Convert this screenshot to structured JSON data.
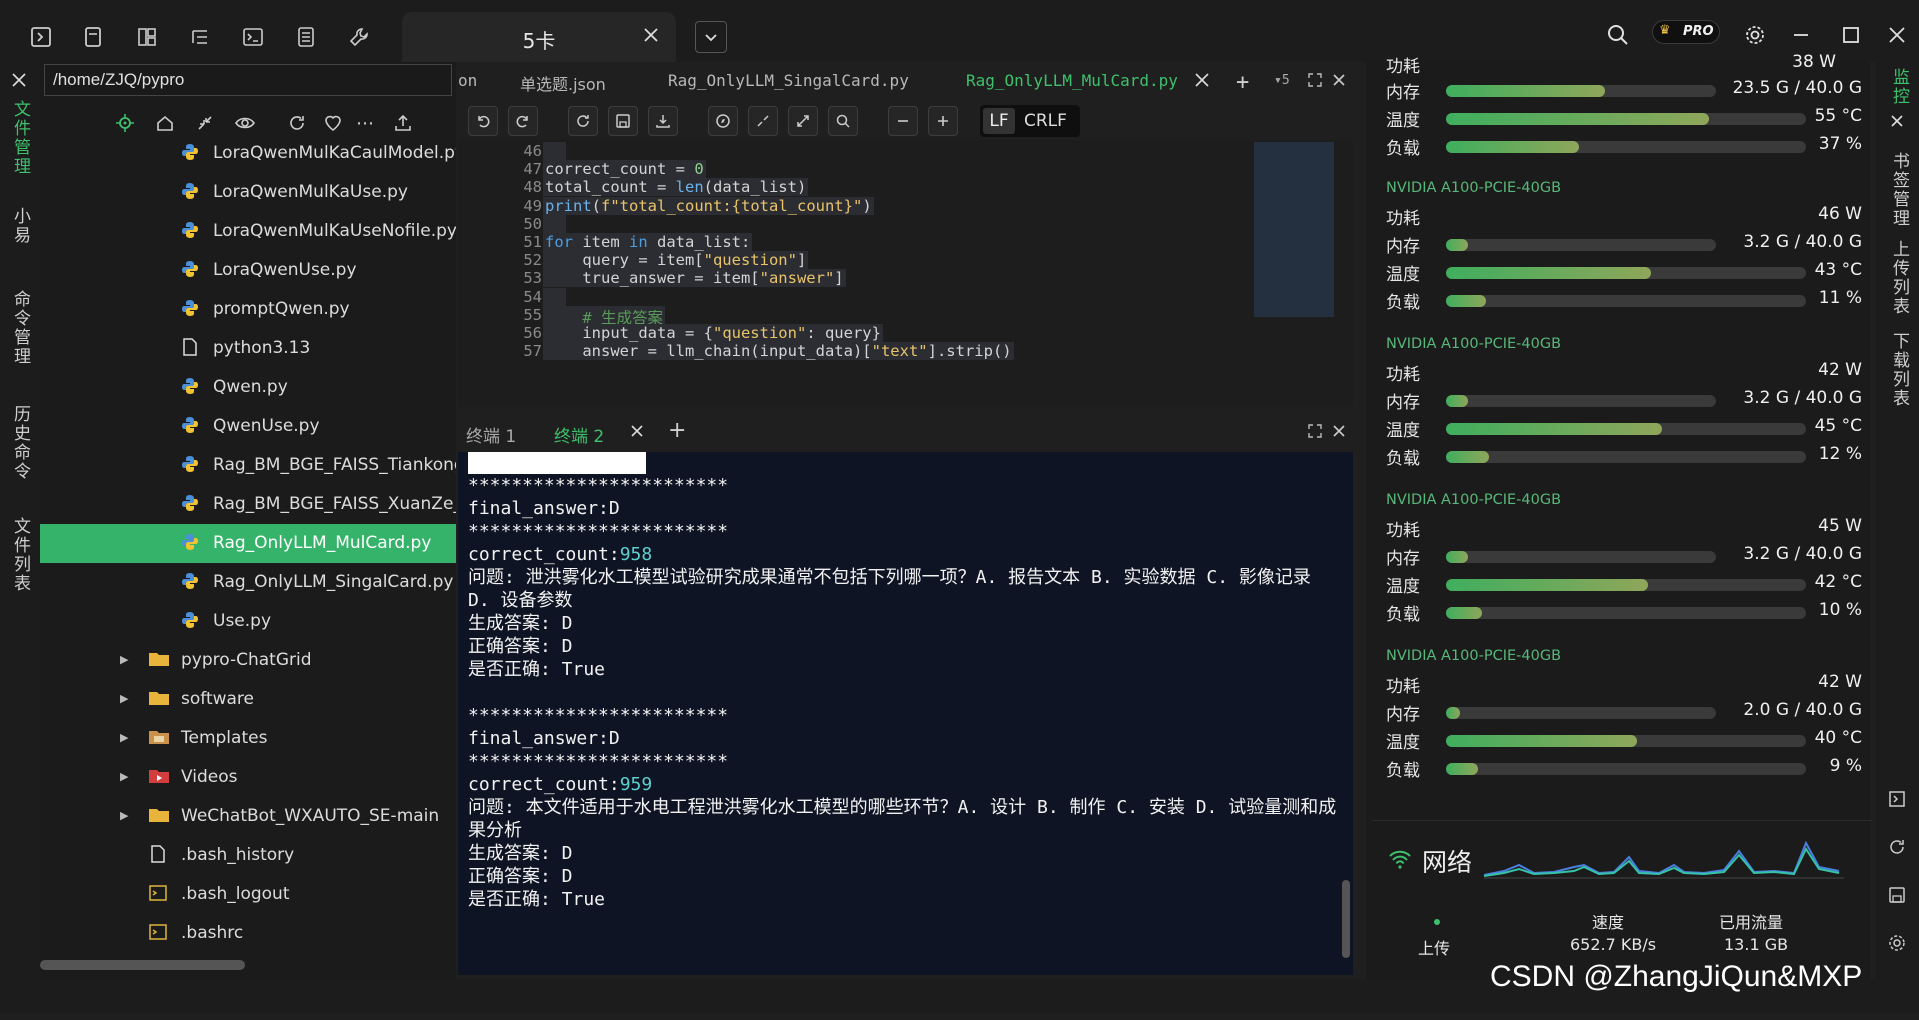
{
  "window": {
    "tab_title": "5卡"
  },
  "left_strip": {
    "items": [
      "文件管理",
      "小易",
      "命令管理",
      "历史命令",
      "文件列表"
    ]
  },
  "file_panel": {
    "path": "/home/ZJQ/pypro",
    "tree": [
      {
        "label": "LoraQwenMulKaCaulModel.py",
        "type": "py",
        "indent": 2
      },
      {
        "label": "LoraQwenMulKaUse.py",
        "type": "py",
        "indent": 2
      },
      {
        "label": "LoraQwenMulKaUseNofile.py",
        "type": "py",
        "indent": 2
      },
      {
        "label": "LoraQwenUse.py",
        "type": "py",
        "indent": 2
      },
      {
        "label": "promptQwen.py",
        "type": "py",
        "indent": 2
      },
      {
        "label": "python3.13",
        "type": "file",
        "indent": 2
      },
      {
        "label": "Qwen.py",
        "type": "py",
        "indent": 2
      },
      {
        "label": "QwenUse.py",
        "type": "py",
        "indent": 2
      },
      {
        "label": "Rag_BM_BGE_FAISS_Tiankong",
        "type": "py",
        "indent": 2
      },
      {
        "label": "Rag_BM_BGE_FAISS_XuanZe_F",
        "type": "py",
        "indent": 2
      },
      {
        "label": "Rag_OnlyLLM_MulCard.py",
        "type": "py",
        "indent": 2,
        "selected": true
      },
      {
        "label": "Rag_OnlyLLM_SingalCard.py",
        "type": "py",
        "indent": 2
      },
      {
        "label": "Use.py",
        "type": "py",
        "indent": 2
      },
      {
        "label": "pypro-ChatGrid",
        "type": "folder",
        "indent": 1
      },
      {
        "label": "software",
        "type": "folder",
        "indent": 1
      },
      {
        "label": "Templates",
        "type": "folder-t",
        "indent": 1
      },
      {
        "label": "Videos",
        "type": "folder-v",
        "indent": 1
      },
      {
        "label": "WeChatBot_WXAUTO_SE-main",
        "type": "folder",
        "indent": 1
      },
      {
        "label": ".bash_history",
        "type": "file",
        "indent": 1
      },
      {
        "label": ".bash_logout",
        "type": "term",
        "indent": 1
      },
      {
        "label": ".bashrc",
        "type": "term",
        "indent": 1
      }
    ]
  },
  "editor": {
    "tabs": [
      "on",
      "单选题.json",
      "Rag_OnlyLLM_SingalCard.py",
      "Rag_OnlyLLM_MulCard.py"
    ],
    "tab_count": "5",
    "line_ending": [
      "LF",
      "CRLF"
    ],
    "lines": [
      {
        "n": "46",
        "html": ""
      },
      {
        "n": "47",
        "html": "correct_count = <span class='nm'>0</span>"
      },
      {
        "n": "48",
        "html": "total_count = <span class='fn'>len</span>(data_list)"
      },
      {
        "n": "49",
        "html": "<span class='fn'>print</span>(<span class='st'>f\"total_count:{total_count}\"</span>)"
      },
      {
        "n": "50",
        "html": ""
      },
      {
        "n": "51",
        "html": "<span class='kw'>for</span> item <span class='kw'>in</span> data_list:"
      },
      {
        "n": "52",
        "html": "    query = item[<span class='st'>\"question\"</span>]"
      },
      {
        "n": "53",
        "html": "    true_answer = item[<span class='st'>\"answer\"</span>]"
      },
      {
        "n": "54",
        "html": ""
      },
      {
        "n": "55",
        "html": "    <span class='cm'># 生成答案</span>"
      },
      {
        "n": "56",
        "html": "    input_data = {<span class='st'>\"question\"</span>: query}"
      },
      {
        "n": "57",
        "html": "    answer = llm_chain(input_data)[<span class='st'>\"text\"</span>].strip()"
      }
    ]
  },
  "terminal": {
    "tabs": [
      "终端 1",
      "终端 2"
    ],
    "lines": [
      {
        "t": "************************"
      },
      {
        "t": "final_answer:D"
      },
      {
        "t": "************************"
      },
      {
        "t": "correct_count:",
        "n": "958"
      },
      {
        "t": "问题: 泄洪雾化水工模型试验研究成果通常不包括下列哪一项？A. 报告文本 B. 实验数据 C. 影像记录 D. 设备参数"
      },
      {
        "t": "生成答案: D"
      },
      {
        "t": "正确答案: D"
      },
      {
        "t": "是否正确: True"
      },
      {
        "t": " "
      },
      {
        "t": "************************"
      },
      {
        "t": "final_answer:D"
      },
      {
        "t": "************************"
      },
      {
        "t": "correct_count:",
        "n": "959"
      },
      {
        "t": "问题: 本文件适用于水电工程泄洪雾化水工模型的哪些环节？A. 设计 B. 制作 C. 安装 D. 试验量测和成果分析"
      },
      {
        "t": "生成答案: D"
      },
      {
        "t": "正确答案: D"
      },
      {
        "t": "是否正确: True"
      }
    ]
  },
  "monitor": {
    "top_partial": {
      "label": "功耗",
      "value": "38 W"
    },
    "first": [
      {
        "k": "内存",
        "v": "23.5 G / 40.0 G",
        "pct": 0.59
      },
      {
        "k": "温度",
        "v": "55 °C",
        "pct": 0.73
      },
      {
        "k": "负载",
        "v": "37 %",
        "pct": 0.37
      }
    ],
    "gpus": [
      {
        "name": "NVIDIA A100-PCIE-40GB",
        "power": "46 W",
        "mem": "3.2 G / 40.0 G",
        "mem_pct": 0.08,
        "temp": "43 °C",
        "temp_pct": 0.57,
        "load": "11 %",
        "load_pct": 0.11
      },
      {
        "name": "NVIDIA A100-PCIE-40GB",
        "power": "42 W",
        "mem": "3.2 G / 40.0 G",
        "mem_pct": 0.08,
        "temp": "45 °C",
        "temp_pct": 0.6,
        "load": "12 %",
        "load_pct": 0.12
      },
      {
        "name": "NVIDIA A100-PCIE-40GB",
        "power": "45 W",
        "mem": "3.2 G / 40.0 G",
        "mem_pct": 0.08,
        "temp": "42 °C",
        "temp_pct": 0.56,
        "load": "10 %",
        "load_pct": 0.1
      },
      {
        "name": "NVIDIA A100-PCIE-40GB",
        "power": "42 W",
        "mem": "2.0 G / 40.0 G",
        "mem_pct": 0.05,
        "temp": "40 °C",
        "temp_pct": 0.53,
        "load": "9 %",
        "load_pct": 0.09
      }
    ],
    "labels": {
      "power": "功耗",
      "mem": "内存",
      "temp": "温度",
      "load": "负载"
    },
    "network": {
      "title": "网络",
      "col_speed": "速度",
      "col_used": "已用流量",
      "upload_label": "上传",
      "upload_speed": "652.7 KB/s",
      "upload_used": "13.1 GB"
    }
  },
  "right_strip": {
    "items": [
      "监控",
      "书签管理",
      "上传列表",
      "下载列表"
    ]
  },
  "watermark": "CSDN @ZhangJiQun&MXP"
}
